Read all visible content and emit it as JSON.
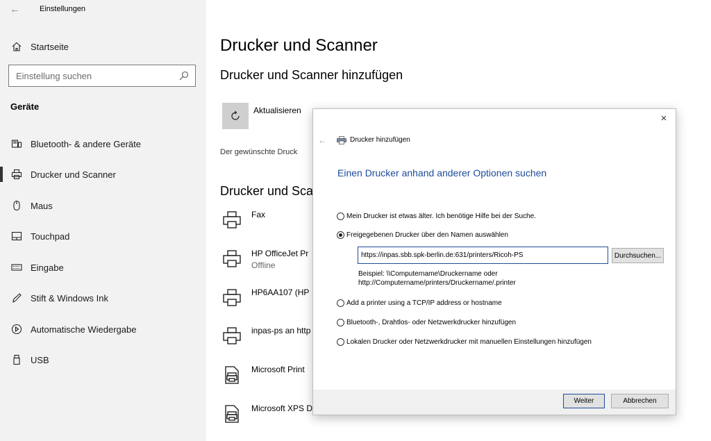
{
  "window": {
    "back_arrow": "←",
    "title": "Einstellungen"
  },
  "sidebar": {
    "home_label": "Startseite",
    "search_placeholder": "Einstellung suchen",
    "section_heading": "Geräte",
    "items": [
      {
        "label": "Bluetooth- & andere Geräte",
        "icon": "bluetooth-devices-icon"
      },
      {
        "label": "Drucker und Scanner",
        "icon": "printer-icon",
        "selected": true
      },
      {
        "label": "Maus",
        "icon": "mouse-icon"
      },
      {
        "label": "Touchpad",
        "icon": "touchpad-icon"
      },
      {
        "label": "Eingabe",
        "icon": "keyboard-icon"
      },
      {
        "label": "Stift & Windows Ink",
        "icon": "pen-icon"
      },
      {
        "label": "Automatische Wiedergabe",
        "icon": "autoplay-icon"
      },
      {
        "label": "USB",
        "icon": "usb-icon"
      }
    ]
  },
  "main": {
    "page_title": "Drucker und Scanner",
    "add_title": "Drucker und Scanner hinzufügen",
    "refresh_label": "Aktualisieren",
    "description": "Der gewünschte Druck",
    "list_title": "Drucker und Sca",
    "printers": [
      {
        "name": "Fax",
        "status": ""
      },
      {
        "name": "HP OfficeJet Pr",
        "status": "Offline"
      },
      {
        "name": "HP6AA107 (HP",
        "status": ""
      },
      {
        "name": "inpas-ps an http",
        "status": ""
      },
      {
        "name": "Microsoft Print",
        "status": ""
      },
      {
        "name": "Microsoft XPS D",
        "status": ""
      }
    ]
  },
  "dialog": {
    "close": "×",
    "back": "←",
    "title": "Drucker hinzufügen",
    "heading": "Einen Drucker anhand anderer Optionen suchen",
    "options": [
      {
        "label": "Mein Drucker ist etwas älter. Ich benötige Hilfe bei der Suche.",
        "checked": false
      },
      {
        "label": "Freigegebenen Drucker über den Namen auswählen",
        "checked": true
      },
      {
        "label": "Add a printer using a TCP/IP address or hostname",
        "checked": false
      },
      {
        "label": "Bluetooth-, Drahtlos- oder Netzwerkdrucker hinzufügen",
        "checked": false
      },
      {
        "label": "Lokalen Drucker oder Netzwerkdrucker mit manuellen Einstellungen hinzufügen",
        "checked": false
      }
    ],
    "url_value": "https://inpas.sbb.spk-berlin.de:631/printers/Ricoh-PS",
    "browse_label": "Durchsuchen...",
    "example_line1": "Beispiel: \\\\Computername\\Druckername oder",
    "example_line2": "http://Computername/printers/Druckername/.printer",
    "next_label": "Weiter",
    "cancel_label": "Abbrechen"
  },
  "colors": {
    "accent": "#1e4b9a",
    "sidebar_bg": "#f2f2f2",
    "refresh_tile": "#cfcfcf"
  }
}
